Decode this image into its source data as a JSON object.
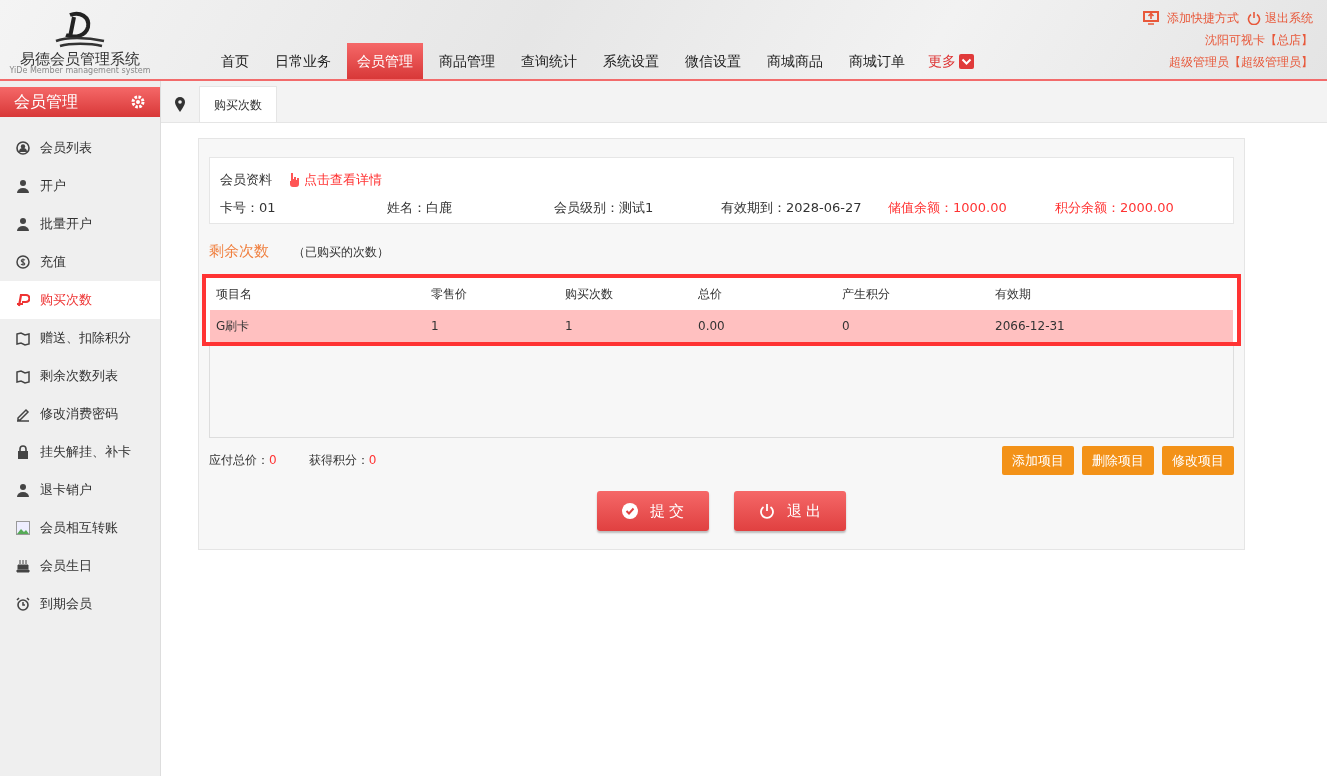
{
  "logo": {
    "title": "易德会员管理系统",
    "subtitle": "YiDe Member management system"
  },
  "nav": [
    {
      "label": "首页",
      "selected": false
    },
    {
      "label": "日常业务",
      "selected": false
    },
    {
      "label": "会员管理",
      "selected": true
    },
    {
      "label": "商品管理",
      "selected": false
    },
    {
      "label": "查询统计",
      "selected": false
    },
    {
      "label": "系统设置",
      "selected": false
    },
    {
      "label": "微信设置",
      "selected": false
    },
    {
      "label": "商城商品",
      "selected": false
    },
    {
      "label": "商城订单",
      "selected": false
    }
  ],
  "nav_more": "更多",
  "top_links": [
    "添加快捷方式",
    "退出系统"
  ],
  "shop": "沈阳可视卡【总店】",
  "user": "超级管理员【超级管理员】",
  "sidebar": {
    "title": "会员管理",
    "items": [
      {
        "label": "会员列表",
        "kind": "usercircle",
        "selected": false
      },
      {
        "label": "开户",
        "kind": "user",
        "selected": false
      },
      {
        "label": "批量开户",
        "kind": "user",
        "selected": false
      },
      {
        "label": "充值",
        "kind": "coin",
        "selected": false
      },
      {
        "label": "购买次数",
        "kind": "pay",
        "selected": true
      },
      {
        "label": "赠送、扣除积分",
        "kind": "map",
        "selected": false
      },
      {
        "label": "剩余次数列表",
        "kind": "map",
        "selected": false
      },
      {
        "label": "修改消费密码",
        "kind": "pen",
        "selected": false
      },
      {
        "label": "挂失解挂、补卡",
        "kind": "lock",
        "selected": false
      },
      {
        "label": "退卡销户",
        "kind": "user",
        "selected": false
      },
      {
        "label": "会员相互转账",
        "kind": "picture",
        "selected": false
      },
      {
        "label": "会员生日",
        "kind": "cake",
        "selected": false
      },
      {
        "label": "到期会员",
        "kind": "alarm",
        "selected": false
      }
    ]
  },
  "tab": "购买次数",
  "member": {
    "label": "会员资料",
    "link": "点击查看详情",
    "fields": [
      {
        "text": "卡号：01",
        "highlight": false
      },
      {
        "text": "姓名：白鹿",
        "highlight": false
      },
      {
        "text": "会员级别：测试1",
        "highlight": false
      },
      {
        "text": "有效期到：2028-06-27",
        "highlight": false
      },
      {
        "text": "储值余额：1000.00",
        "highlight": true
      },
      {
        "text": "积分余额：2000.00",
        "highlight": true
      }
    ]
  },
  "section": {
    "title": "剩余次数",
    "note": "（已购买的次数）"
  },
  "table": {
    "columns": [
      "项目名",
      "零售价",
      "购买次数",
      "总价",
      "产生积分",
      "有效期"
    ],
    "rows": [
      {
        "cells": [
          "G刷卡",
          "1",
          "1",
          "0.00",
          "0",
          "2066-12-31"
        ],
        "selected": true
      }
    ]
  },
  "totals": [
    {
      "label": "应付总价：",
      "value": "0"
    },
    {
      "label": "获得积分：",
      "value": "0"
    }
  ],
  "actions": [
    "添加项目",
    "删除项目",
    "修改项目"
  ],
  "submit": "提 交",
  "exit": "退 出"
}
